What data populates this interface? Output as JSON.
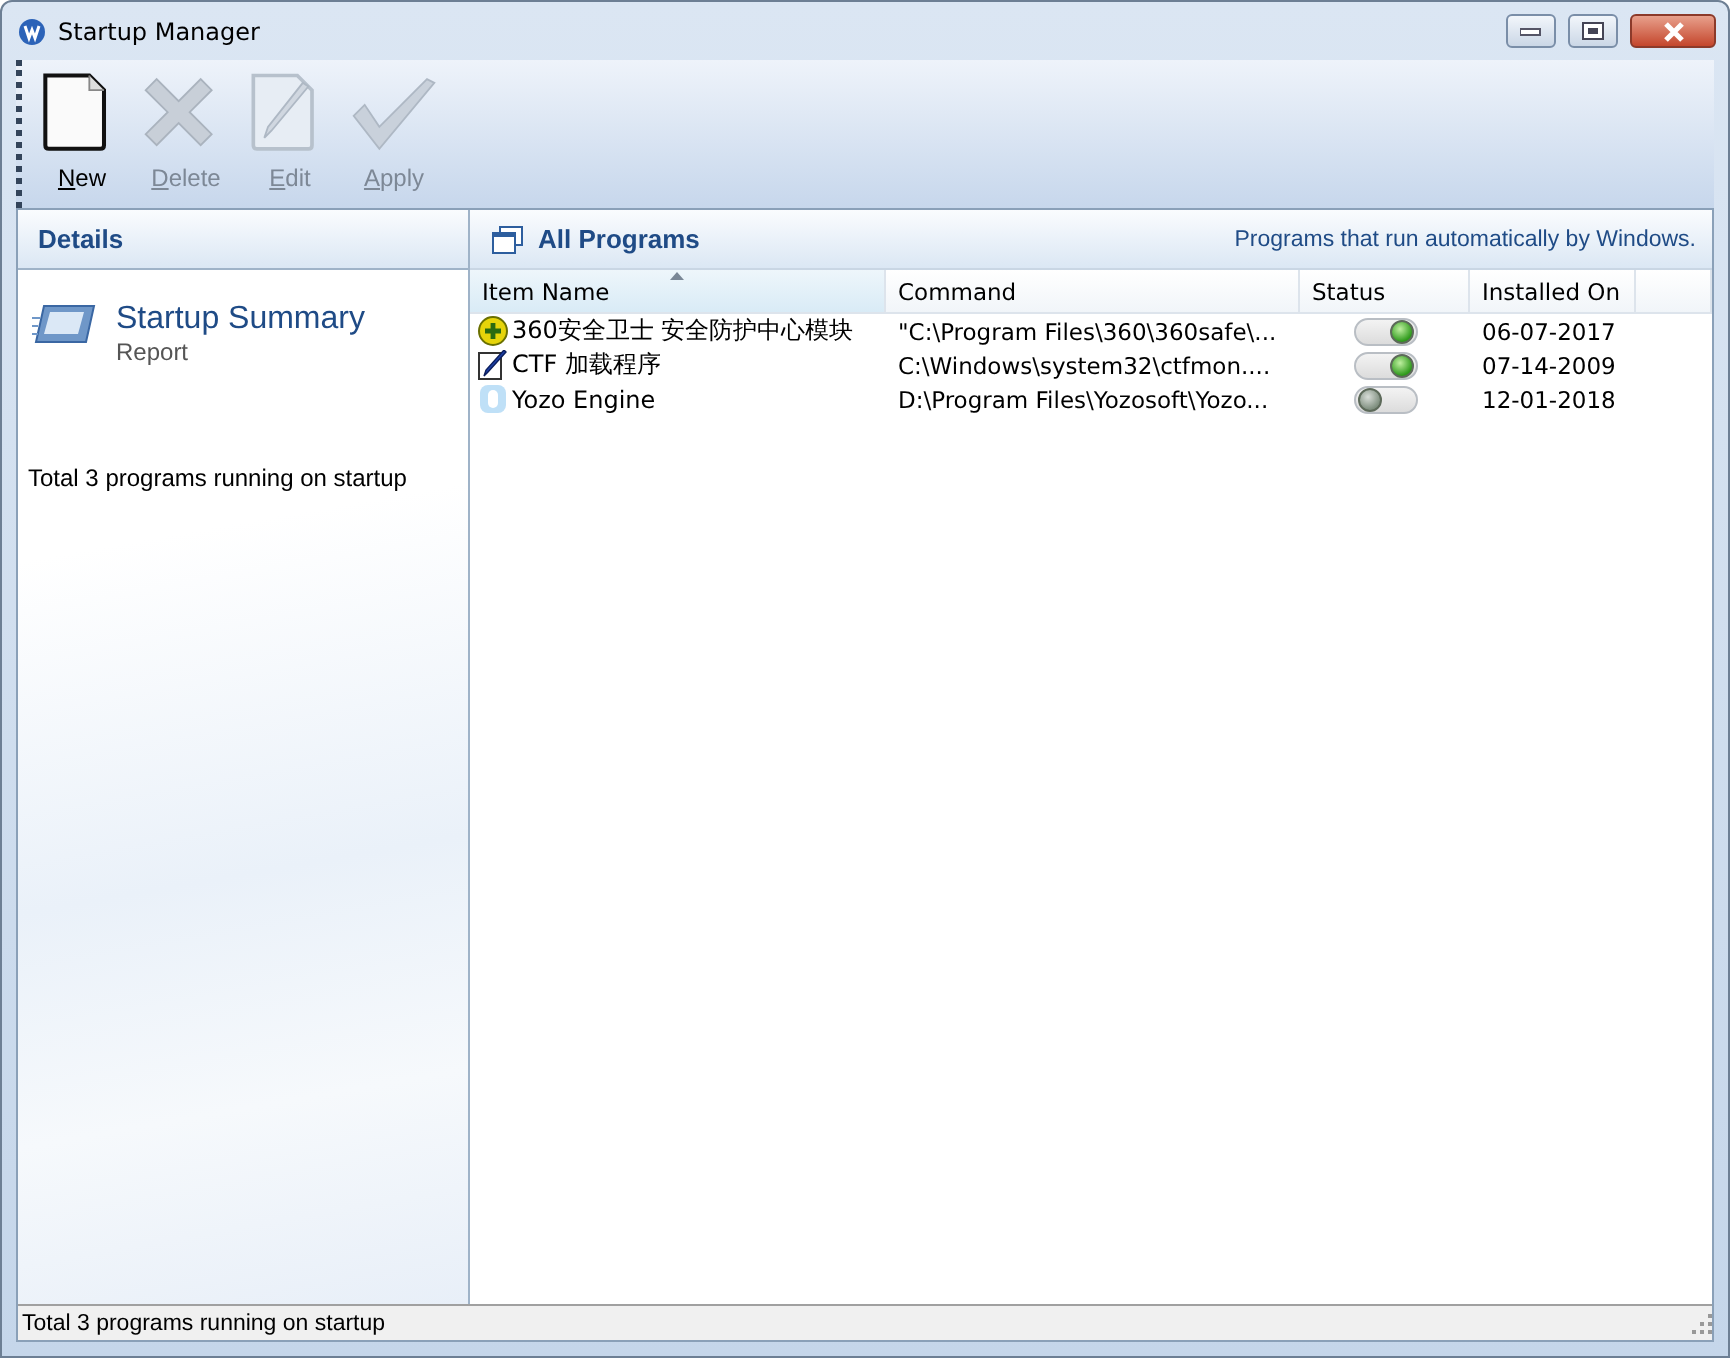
{
  "window": {
    "title": "Startup Manager"
  },
  "toolbar": [
    {
      "kind": "new",
      "label": "New",
      "disabled": false
    },
    {
      "kind": "delete",
      "label": "Delete",
      "disabled": true
    },
    {
      "kind": "edit",
      "label": "Edit",
      "disabled": true
    },
    {
      "kind": "apply",
      "label": "Apply",
      "disabled": true
    }
  ],
  "details": {
    "heading": "Details",
    "summary_title": "Startup Summary",
    "summary_subtitle": "Report",
    "summary_text": "Total 3 programs running on startup"
  },
  "programs": {
    "heading": "All Programs",
    "description": "Programs that run automatically by Windows.",
    "columns": [
      {
        "label": "Item Name",
        "sorted": true
      },
      {
        "label": "Command",
        "sorted": false
      },
      {
        "label": "Status",
        "sorted": false
      },
      {
        "label": "Installed On",
        "sorted": false
      }
    ],
    "rows": [
      {
        "kind": "shield",
        "name": "360安全卫士 安全防护中心模块",
        "command": "\"C:\\Program Files\\360\\360safe\\...",
        "on": true,
        "installed": "06-07-2017"
      },
      {
        "kind": "pen",
        "name": "CTF 加载程序",
        "command": "C:\\Windows\\system32\\ctfmon....",
        "on": true,
        "installed": "07-14-2009"
      },
      {
        "kind": "drop",
        "name": "Yozo Engine",
        "command": "D:\\Program Files\\Yozosoft\\Yozo...",
        "on": false,
        "installed": "12-01-2018"
      }
    ]
  },
  "status_bar": {
    "text": "Total 3 programs running on startup"
  }
}
